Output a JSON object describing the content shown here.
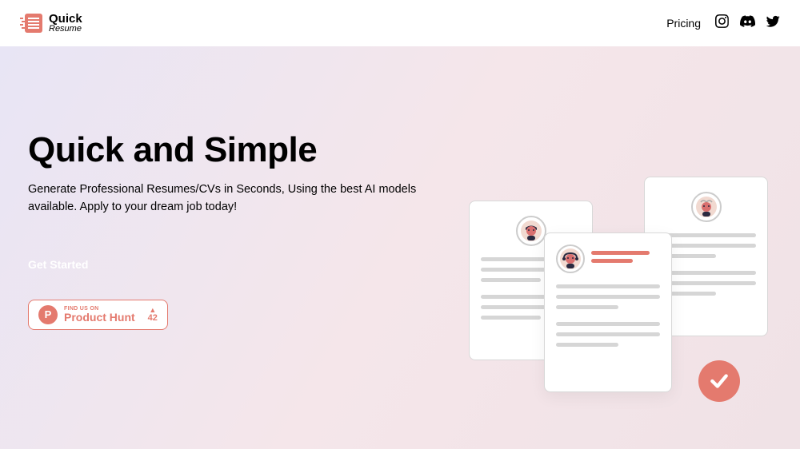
{
  "header": {
    "logo_top": "Quick",
    "logo_bottom": "Resume",
    "nav_link": "Pricing"
  },
  "hero": {
    "title": "Quick and Simple",
    "subtitle": "Generate Professional Resumes/CVs in Seconds, Using the best AI models available. Apply to your dream job today!",
    "cta_label": "Get Started"
  },
  "product_hunt": {
    "badge_letter": "P",
    "top_text": "FIND US ON",
    "name": "Product Hunt",
    "votes": "42"
  },
  "colors": {
    "accent": "#e47a6e"
  }
}
